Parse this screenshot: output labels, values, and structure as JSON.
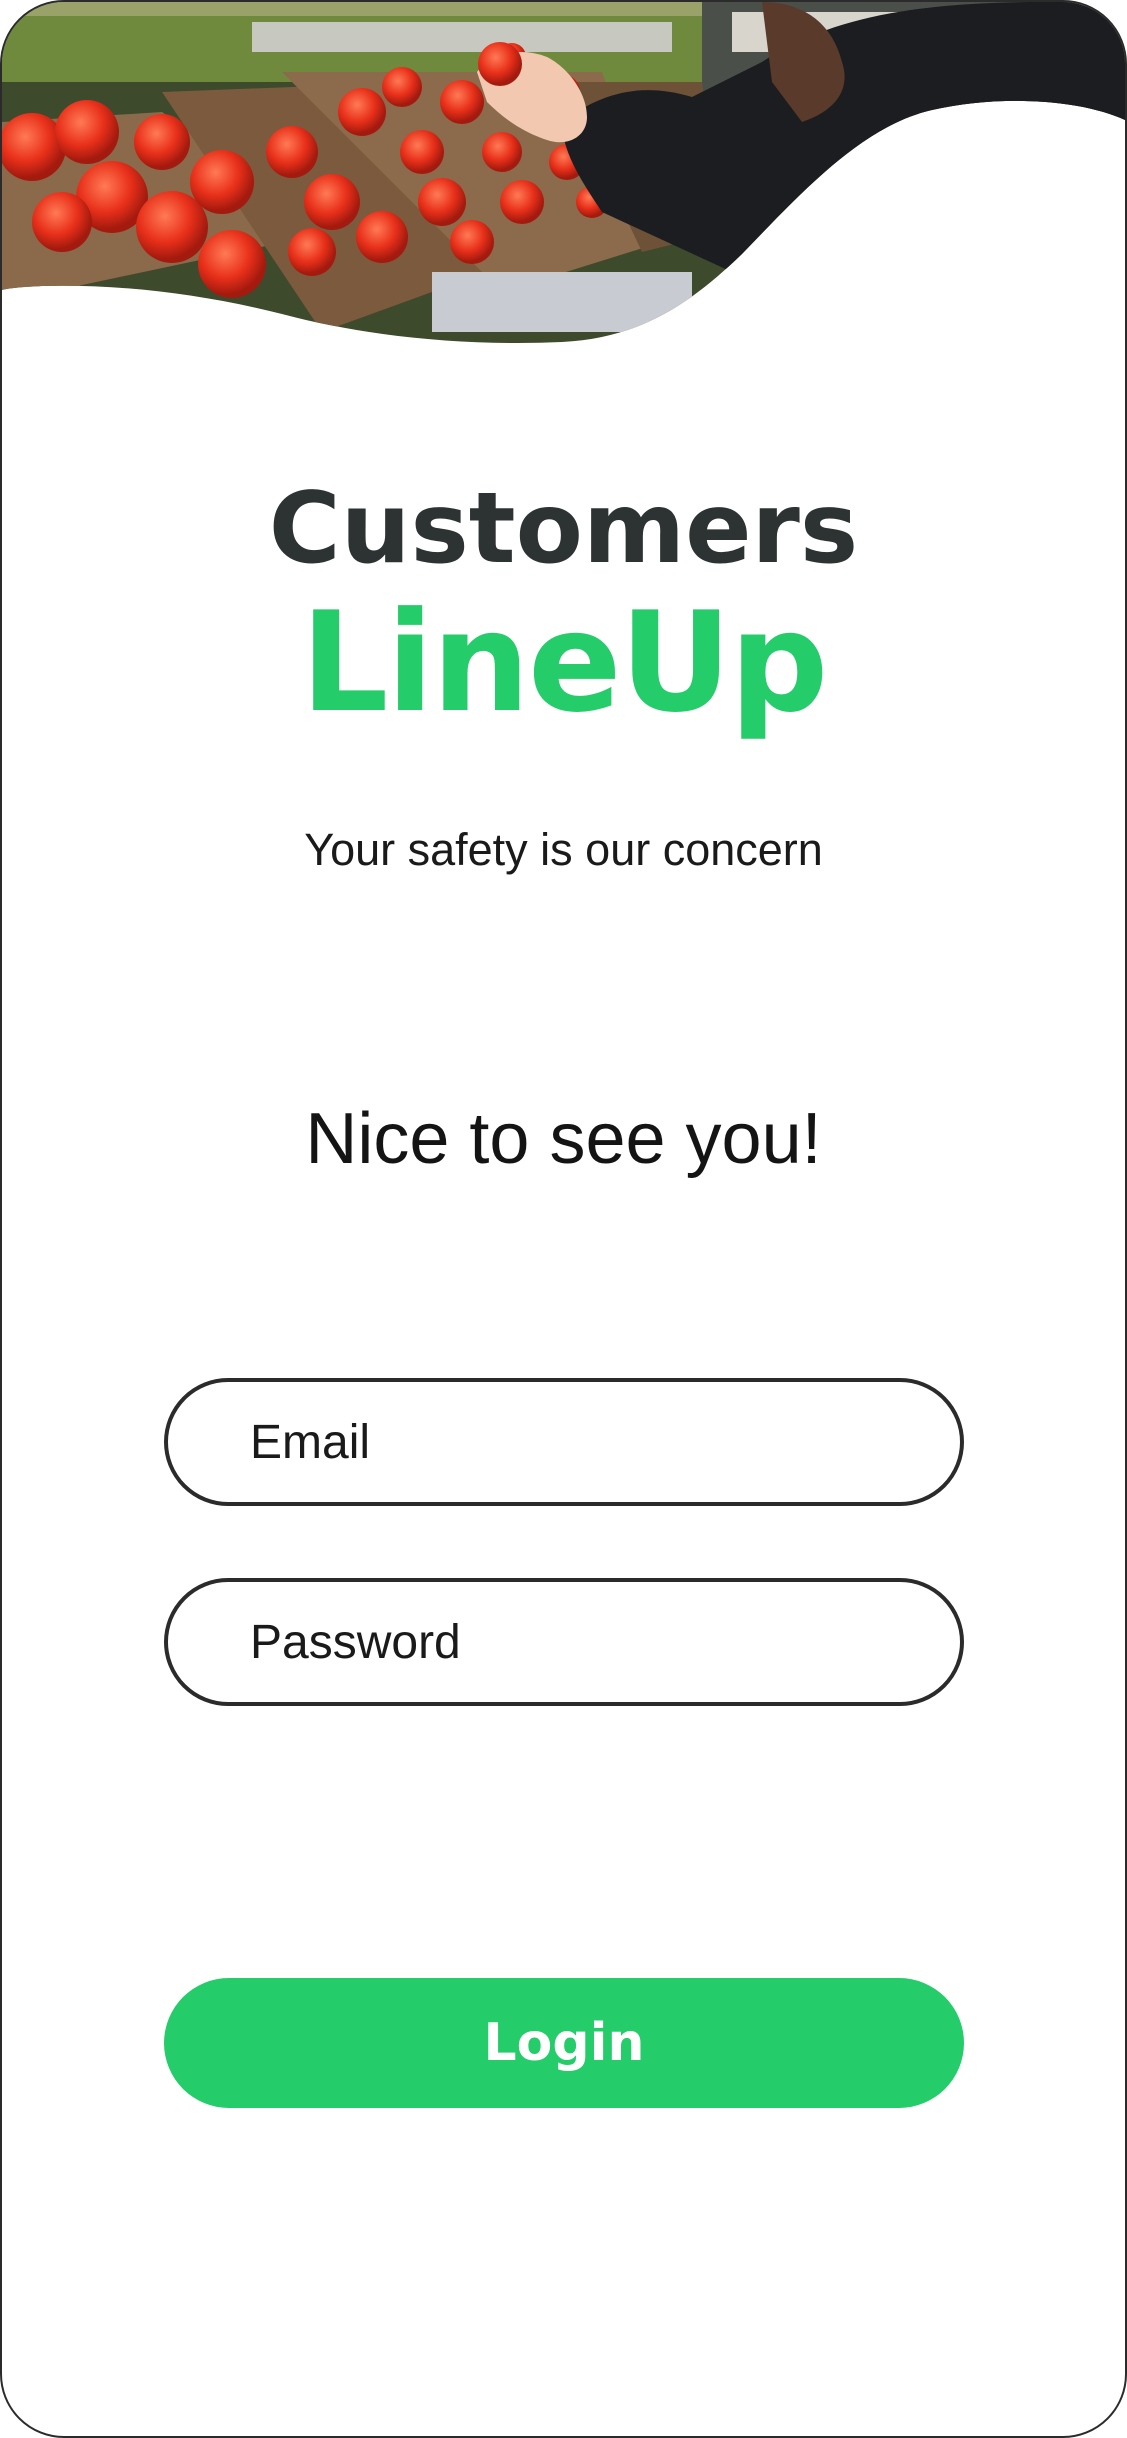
{
  "brand": {
    "line1": "Customers",
    "line2": "LineUp"
  },
  "tagline": "Your safety is our concern",
  "greeting": "Nice to see you!",
  "form": {
    "email_placeholder": "Email",
    "password_placeholder": "Password",
    "login_label": "Login"
  },
  "hero": {
    "image": "grocery-tomatoes-photo"
  },
  "colors": {
    "accent": "#24cc6a",
    "heading": "#2d3333",
    "border": "#2b2b2b"
  }
}
